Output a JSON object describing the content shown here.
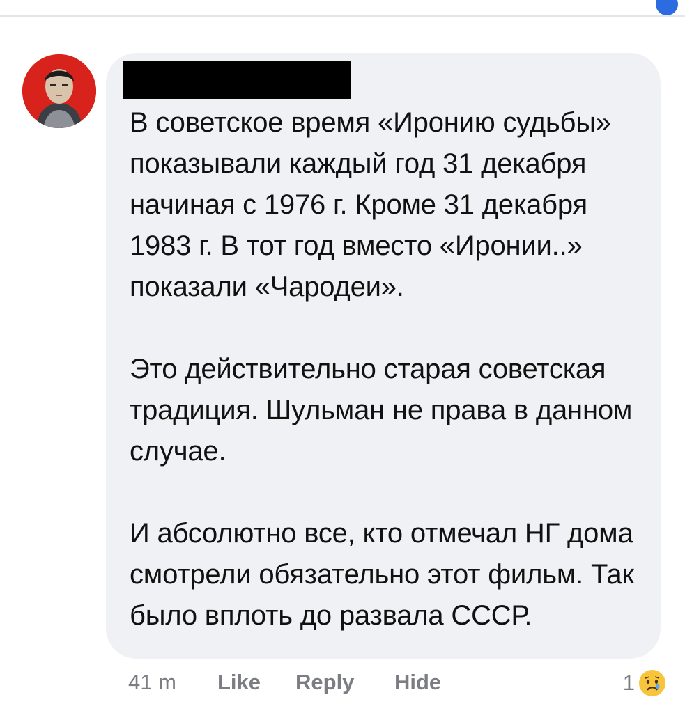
{
  "comment": {
    "paragraphs": [
      "В советское время «Иронию судьбы» показывали каждый год 31 декабря начиная с 1976 г. Кроме 31 декабря 1983 г. В тот год вместо «Иронии..» показали «Чародеи».",
      "Это действительно старая советская традиция. Шульман не права в данном случае.",
      "И абсолютно все, кто отмечал НГ дома смотрели обязательно этот фильм. Так было вплоть до развала СССР."
    ],
    "avatar_icon": "user-avatar-icon",
    "name_redacted": true
  },
  "actions": {
    "time": "41 m",
    "like_label": "Like",
    "reply_label": "Reply",
    "hide_label": "Hide"
  },
  "reactions": {
    "count": "1",
    "icon": "sad-reaction-icon"
  },
  "colors": {
    "bubble": "#f0f1f4",
    "muted_text": "#7b7d82",
    "avatar_bg": "#d8231c",
    "reaction_yellow": "#f7c43b"
  }
}
